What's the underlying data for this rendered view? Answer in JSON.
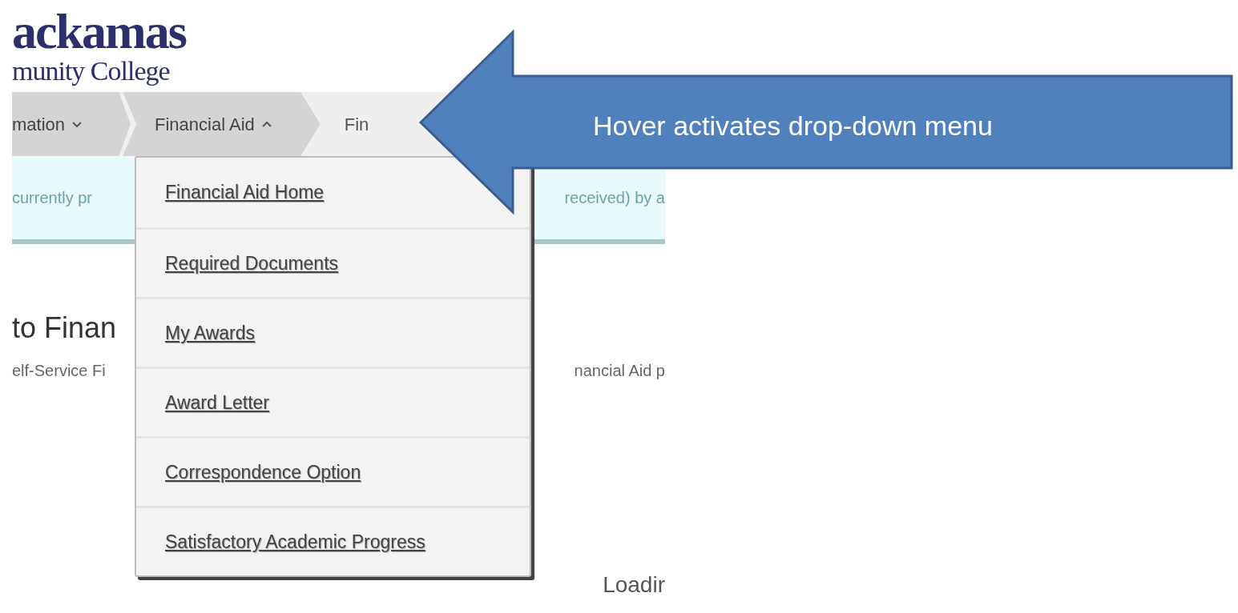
{
  "logo": {
    "line_1": "ackamas",
    "line_2": "munity College"
  },
  "nav": [
    {
      "label": "mation",
      "kind": "menu",
      "expanded": false
    },
    {
      "label": "Financial Aid",
      "kind": "menu",
      "expanded": true
    },
    {
      "label": "Fin",
      "kind": "link"
    }
  ],
  "banner": {
    "left_text": "currently pr",
    "right_text": "received) by a"
  },
  "heading": "to Finan",
  "intro": {
    "left_text": "elf-Service Fi",
    "right_text": "nancial Aid p"
  },
  "dropdown": {
    "items": [
      "Financial Aid Home",
      "Required Documents",
      "My Awards",
      "Award Letter",
      "Correspondence Option",
      "Satisfactory Academic Progress"
    ]
  },
  "loading": "Loadir",
  "annotation": {
    "text": "Hover activates drop-down menu"
  }
}
